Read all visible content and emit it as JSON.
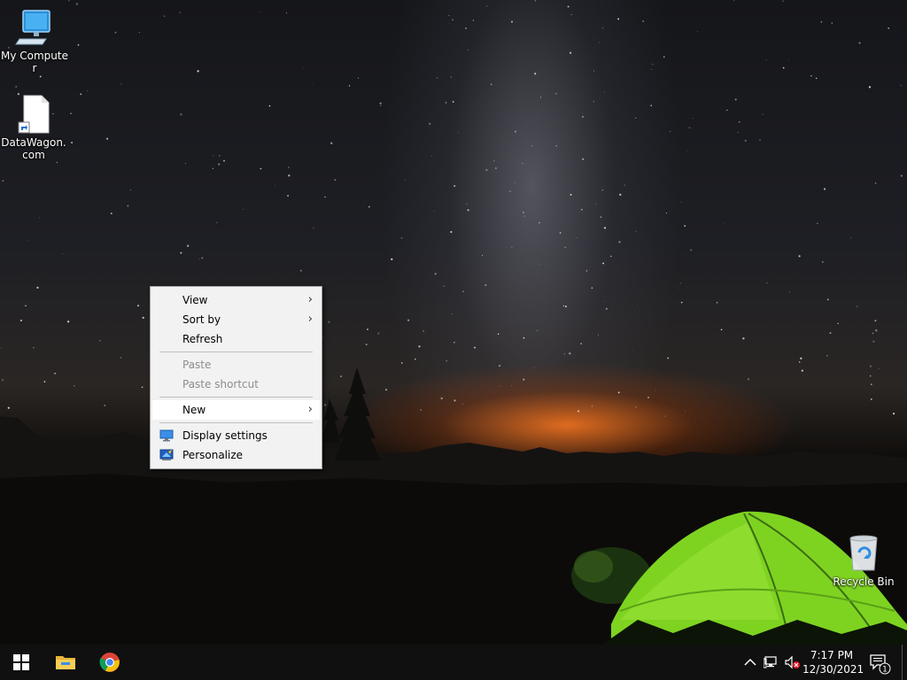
{
  "desktop": {
    "icons": [
      {
        "label": "My Computer",
        "icon": "monitor-icon"
      },
      {
        "label": "DataWagon.com",
        "icon": "shortcut-file-icon"
      },
      {
        "label": "Recycle Bin",
        "icon": "recycle-bin-icon"
      }
    ]
  },
  "context_menu": {
    "items": [
      {
        "label": "View",
        "has_submenu": true,
        "enabled": true
      },
      {
        "label": "Sort by",
        "has_submenu": true,
        "enabled": true
      },
      {
        "label": "Refresh",
        "has_submenu": false,
        "enabled": true
      },
      {
        "label": "Paste",
        "has_submenu": false,
        "enabled": false
      },
      {
        "label": "Paste shortcut",
        "has_submenu": false,
        "enabled": false
      },
      {
        "label": "New",
        "has_submenu": true,
        "enabled": true,
        "highlighted": true
      },
      {
        "label": "Display settings",
        "has_submenu": false,
        "enabled": true,
        "icon": "display-icon"
      },
      {
        "label": "Personalize",
        "has_submenu": false,
        "enabled": true,
        "icon": "personalize-icon"
      }
    ],
    "submenu_arrow": "›"
  },
  "taskbar": {
    "pinned": [
      {
        "name": "start",
        "icon": "windows-logo-icon"
      },
      {
        "name": "file-explorer",
        "icon": "folder-icon"
      },
      {
        "name": "chrome",
        "icon": "chrome-icon"
      }
    ],
    "tray": {
      "icons": [
        "chevron-up-icon",
        "network-icon",
        "volume-muted-icon"
      ],
      "time": "7:17 PM",
      "date": "12/30/2021",
      "notification_count": "1"
    }
  },
  "colors": {
    "menu_bg": "#f2f2f2",
    "menu_disabled_text": "#8c8c8c",
    "taskbar_bg": "#101010",
    "tent_green": "#7ed321"
  }
}
